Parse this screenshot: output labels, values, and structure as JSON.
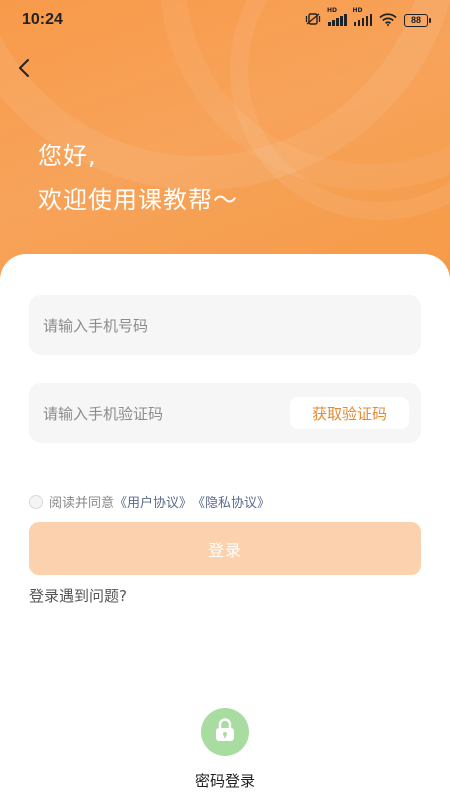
{
  "status_bar": {
    "time": "10:24",
    "battery": "88",
    "signal_badge_1": "HD",
    "signal_badge_2": "HD"
  },
  "header": {
    "back_icon": "chevron-left-icon",
    "greeting_line1": "您好,",
    "greeting_line2": "欢迎使用课教帮～"
  },
  "form": {
    "phone_placeholder": "请输入手机号码",
    "code_placeholder": "请输入手机验证码",
    "get_code_label": "获取验证码",
    "agree_prefix": "阅读并同意",
    "user_agreement": "《用户协议》",
    "privacy_policy": "《隐私协议》",
    "login_label": "登录",
    "help_label": "登录遇到问题?"
  },
  "alt_login": {
    "icon": "lock-icon",
    "label": "密码登录"
  },
  "colors": {
    "accent": "#f7a04e",
    "login_disabled": "#fbd2ad",
    "get_code_text": "#e8892e",
    "lock_bg": "#a9dca0"
  }
}
